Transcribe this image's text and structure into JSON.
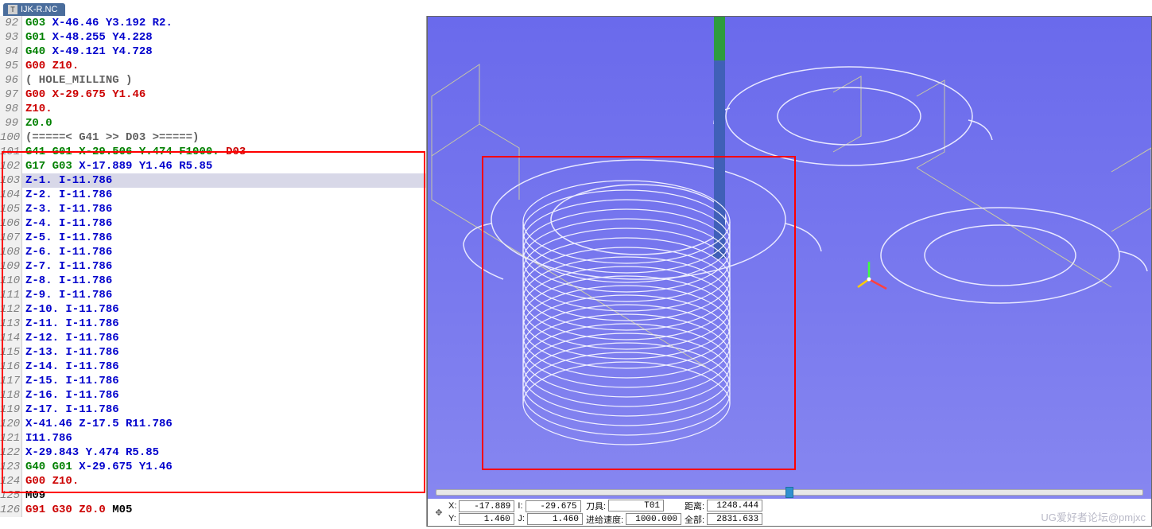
{
  "tab": {
    "label": "IJK-R.NC"
  },
  "code": {
    "lines": [
      {
        "num": 92,
        "tokens": [
          [
            "G03",
            "green"
          ],
          [
            " ",
            "black"
          ],
          [
            "X-46.46 Y3.192 R2.",
            "blue"
          ]
        ]
      },
      {
        "num": 93,
        "tokens": [
          [
            "G01",
            "green"
          ],
          [
            " ",
            "black"
          ],
          [
            "X-48.255 Y4.228",
            "blue"
          ]
        ]
      },
      {
        "num": 94,
        "tokens": [
          [
            "G40",
            "green"
          ],
          [
            " ",
            "black"
          ],
          [
            "X-49.121 Y4.728",
            "blue"
          ]
        ]
      },
      {
        "num": 95,
        "tokens": [
          [
            "G00",
            "red"
          ],
          [
            " ",
            "black"
          ],
          [
            "Z10.",
            "red"
          ]
        ]
      },
      {
        "num": 96,
        "tokens": [
          [
            "( HOLE_MILLING )",
            "gray"
          ]
        ]
      },
      {
        "num": 97,
        "tokens": [
          [
            "G00",
            "red"
          ],
          [
            " ",
            "black"
          ],
          [
            "X-29.675 Y1.46",
            "red"
          ]
        ]
      },
      {
        "num": 98,
        "tokens": [
          [
            "Z10.",
            "red"
          ]
        ]
      },
      {
        "num": 99,
        "tokens": [
          [
            "Z0.0",
            "green"
          ]
        ]
      },
      {
        "num": 100,
        "tokens": [
          [
            "(=====< G41 >> D03 >=====)",
            "gray"
          ]
        ]
      },
      {
        "num": 101,
        "tokens": [
          [
            "G41 G01",
            "green"
          ],
          [
            " ",
            "black"
          ],
          [
            "X-29.506 Y.474 F1000.",
            "green"
          ],
          [
            " ",
            "black"
          ],
          [
            "D03",
            "red"
          ]
        ]
      },
      {
        "num": 102,
        "tokens": [
          [
            "G17 G03",
            "green"
          ],
          [
            " ",
            "black"
          ],
          [
            "X-17.889 Y1.46 R5.85",
            "blue"
          ]
        ]
      },
      {
        "num": 103,
        "tokens": [
          [
            "Z-1. I-11.786",
            "blue"
          ]
        ],
        "highlight": true
      },
      {
        "num": 104,
        "tokens": [
          [
            "Z-2. I-11.786",
            "blue"
          ]
        ]
      },
      {
        "num": 105,
        "tokens": [
          [
            "Z-3. I-11.786",
            "blue"
          ]
        ]
      },
      {
        "num": 106,
        "tokens": [
          [
            "Z-4. I-11.786",
            "blue"
          ]
        ]
      },
      {
        "num": 107,
        "tokens": [
          [
            "Z-5. I-11.786",
            "blue"
          ]
        ]
      },
      {
        "num": 108,
        "tokens": [
          [
            "Z-6. I-11.786",
            "blue"
          ]
        ]
      },
      {
        "num": 109,
        "tokens": [
          [
            "Z-7. I-11.786",
            "blue"
          ]
        ]
      },
      {
        "num": 110,
        "tokens": [
          [
            "Z-8. I-11.786",
            "blue"
          ]
        ]
      },
      {
        "num": 111,
        "tokens": [
          [
            "Z-9. I-11.786",
            "blue"
          ]
        ]
      },
      {
        "num": 112,
        "tokens": [
          [
            "Z-10. I-11.786",
            "blue"
          ]
        ]
      },
      {
        "num": 113,
        "tokens": [
          [
            "Z-11. I-11.786",
            "blue"
          ]
        ]
      },
      {
        "num": 114,
        "tokens": [
          [
            "Z-12. I-11.786",
            "blue"
          ]
        ]
      },
      {
        "num": 115,
        "tokens": [
          [
            "Z-13. I-11.786",
            "blue"
          ]
        ]
      },
      {
        "num": 116,
        "tokens": [
          [
            "Z-14. I-11.786",
            "blue"
          ]
        ]
      },
      {
        "num": 117,
        "tokens": [
          [
            "Z-15. I-11.786",
            "blue"
          ]
        ]
      },
      {
        "num": 118,
        "tokens": [
          [
            "Z-16. I-11.786",
            "blue"
          ]
        ]
      },
      {
        "num": 119,
        "tokens": [
          [
            "Z-17. I-11.786",
            "blue"
          ]
        ]
      },
      {
        "num": 120,
        "tokens": [
          [
            "X-41.46 Z-17.5 R11.786",
            "blue"
          ]
        ]
      },
      {
        "num": 121,
        "tokens": [
          [
            "I11.786",
            "blue"
          ]
        ]
      },
      {
        "num": 122,
        "tokens": [
          [
            "X-29.843 Y.474 R5.85",
            "blue"
          ]
        ]
      },
      {
        "num": 123,
        "tokens": [
          [
            "G40 G01",
            "green"
          ],
          [
            " ",
            "black"
          ],
          [
            "X-29.675 Y1.46",
            "blue"
          ]
        ]
      },
      {
        "num": 124,
        "tokens": [
          [
            "G00",
            "red"
          ],
          [
            " ",
            "black"
          ],
          [
            "Z10.",
            "red"
          ]
        ]
      },
      {
        "num": 125,
        "tokens": [
          [
            "M09",
            "black"
          ]
        ]
      },
      {
        "num": 126,
        "tokens": [
          [
            "G91 G30",
            "red"
          ],
          [
            " ",
            "black"
          ],
          [
            "Z0.0",
            "red"
          ],
          [
            " ",
            "black"
          ],
          [
            "M05",
            "black"
          ]
        ]
      }
    ]
  },
  "status": {
    "x_label": "X:",
    "x_value": "-17.889",
    "y_label": "Y:",
    "y_value": "1.460",
    "i_label": "I:",
    "i_value": "-29.675",
    "j_label": "J:",
    "j_value": "1.460",
    "tool_label": "刀具:",
    "tool_value": "T01",
    "feed_label": "进给速度:",
    "feed_value": "1000.000",
    "dist_label": "距离:",
    "dist_value": "1248.444",
    "total_label": "全部:",
    "total_value": "2831.633"
  },
  "watermark": "UG爱好者论坛@pmjxc"
}
